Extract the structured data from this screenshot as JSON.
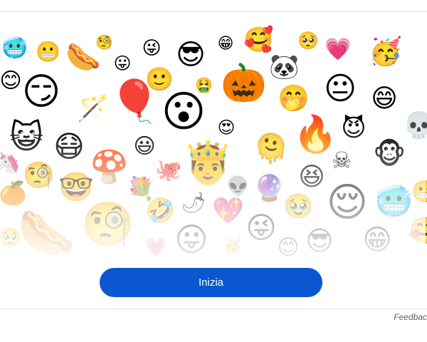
{
  "start_button": {
    "label": "Inizia"
  },
  "feedback": {
    "label": "Feedback"
  },
  "colors": {
    "primary_button": "#0b57d0",
    "card_border": "#e3e3e3",
    "feedback_text": "#5f6368"
  },
  "emojis": [
    {
      "name": "cold-face-emoji",
      "char": "🥶"
    },
    {
      "name": "grinning-emoji",
      "char": "😬"
    },
    {
      "name": "hotdog-emoji",
      "char": "🌭"
    },
    {
      "name": "one-eye-emoji",
      "char": "🧐"
    },
    {
      "name": "tongue-out-emoji",
      "char": "😛"
    },
    {
      "name": "tongue-wink-emoji",
      "char": "😜"
    },
    {
      "name": "sunglasses-emoji",
      "char": "😎"
    },
    {
      "name": "small-grin-emoji",
      "char": "😁"
    },
    {
      "name": "flower-crown-emoji",
      "char": "🥰"
    },
    {
      "name": "pleading-emoji",
      "char": "🥺"
    },
    {
      "name": "heart-face-emoji",
      "char": "💗"
    },
    {
      "name": "party-emoji",
      "char": "🥳"
    },
    {
      "name": "smiling-emoji",
      "char": "😊"
    },
    {
      "name": "big-smirk-emoji",
      "char": "😏"
    },
    {
      "name": "balloon-emoji",
      "char": "🎈"
    },
    {
      "name": "smile-emoji",
      "char": "🙂"
    },
    {
      "name": "sick-emoji",
      "char": "🤮"
    },
    {
      "name": "pumpkin-emoji",
      "char": "🎃"
    },
    {
      "name": "panda-emoji",
      "char": "🐼"
    },
    {
      "name": "hand-mouth-emoji",
      "char": "🤭"
    },
    {
      "name": "neutral-emoji",
      "char": "😐"
    },
    {
      "name": "grin-emoji",
      "char": "😄"
    },
    {
      "name": "wand-blob-emoji",
      "char": "🪄"
    },
    {
      "name": "wow-emoji",
      "char": "😮"
    },
    {
      "name": "cat-emoji",
      "char": "😺"
    },
    {
      "name": "mask-emoji",
      "char": "😷"
    },
    {
      "name": "fire-emoji",
      "char": "🔥"
    },
    {
      "name": "devil-emoji",
      "char": "😈"
    },
    {
      "name": "skull-emoji",
      "char": "💀"
    },
    {
      "name": "beam-emoji",
      "char": "😃"
    },
    {
      "name": "hearts-emoji",
      "char": "😍"
    },
    {
      "name": "triangle-emoji",
      "char": "🫠"
    },
    {
      "name": "skull-right-emoji",
      "char": "☠"
    },
    {
      "name": "monkey-emoji",
      "char": "🐵"
    },
    {
      "name": "unicorn-emoji",
      "char": "🦄"
    },
    {
      "name": "mushroom-emoji",
      "char": "🍄"
    },
    {
      "name": "octopus-emoji",
      "char": "🐙"
    },
    {
      "name": "crown-emoji",
      "char": "🤴"
    },
    {
      "name": "monocle-emoji",
      "char": "🧐"
    },
    {
      "name": "alien-emoji",
      "char": "👽"
    },
    {
      "name": "crystal-ball-emoji",
      "char": "🔮"
    },
    {
      "name": "laugh-emoji",
      "char": "😆"
    },
    {
      "name": "orange-emoji",
      "char": "🍊"
    },
    {
      "name": "nerd-emoji",
      "char": "🤓"
    },
    {
      "name": "bouquet-emoji",
      "char": "💐"
    },
    {
      "name": "rofl-emoji",
      "char": "🤣"
    },
    {
      "name": "chili-emoji",
      "char": "🌶"
    },
    {
      "name": "heart-emoji",
      "char": "💖"
    },
    {
      "name": "tear-emoji",
      "char": "🥹"
    },
    {
      "name": "relieved-emoji",
      "char": "😌"
    }
  ]
}
